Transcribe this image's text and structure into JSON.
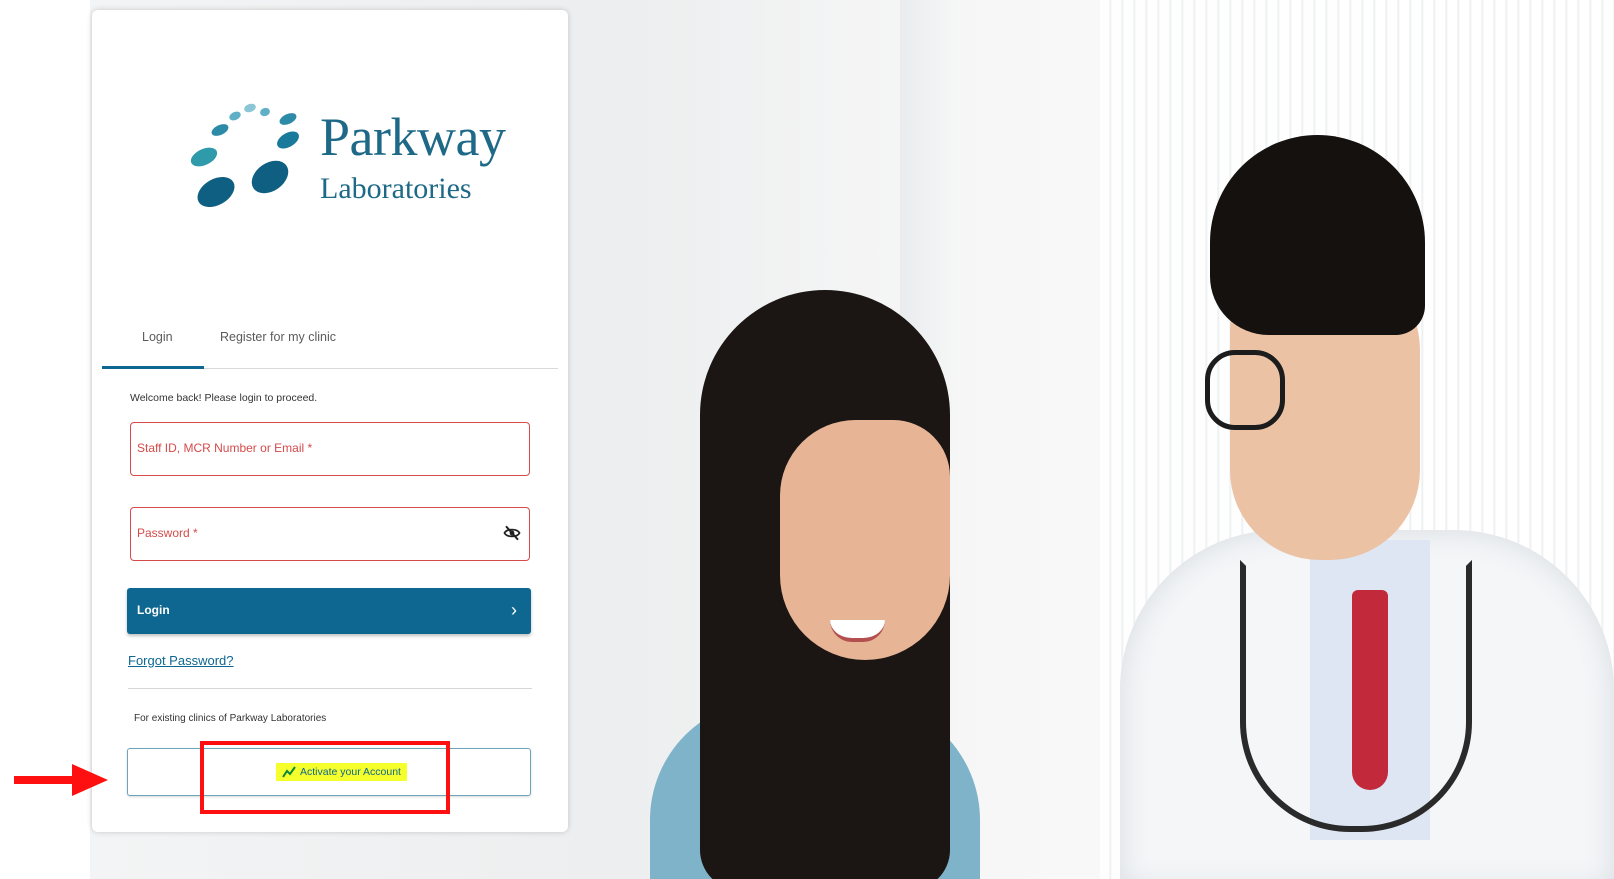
{
  "brand": {
    "name": "Parkway",
    "subtitle": "Laboratories",
    "colors": {
      "primary": "#1d6987",
      "dot_light": "#5fb0c6",
      "dot_dark": "#0e5f82"
    }
  },
  "tabs": [
    {
      "label": "Login",
      "active": true
    },
    {
      "label": "Register for my clinic",
      "active": false
    }
  ],
  "login_form": {
    "welcome_text": "Welcome back! Please login to proceed.",
    "username_placeholder": "Staff ID, MCR Number or Email *",
    "password_placeholder": "Password *",
    "password_toggle_icon": "eye-off-icon",
    "login_button_label": "Login",
    "login_button_icon": "chevron-right-icon",
    "forgot_password_label": "Forgot Password?",
    "existing_clinics_text": "For existing clinics of Parkway Laboratories",
    "activate_button_label": "Activate your Account",
    "activate_button_icon": "trending-line-icon"
  },
  "annotations": {
    "highlight_color": "#ff1010",
    "highlight_fill": "#f4ff2b",
    "arrow_icon": "red-arrow-right-icon"
  },
  "colors": {
    "accent": "#0e6791",
    "error": "#d64a4a"
  }
}
